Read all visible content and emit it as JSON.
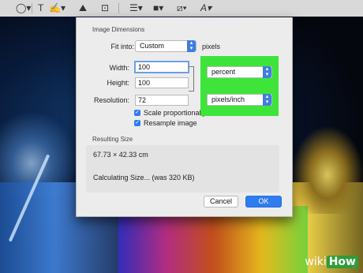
{
  "toolbar": {
    "items": [
      {
        "name": "shapes-icon",
        "glyph": "◯▾"
      },
      {
        "name": "text-icon",
        "glyph": "T"
      },
      {
        "name": "sign-icon",
        "glyph": "✍▾"
      },
      {
        "name": "adjust-color-icon",
        "glyph": "⛰"
      },
      {
        "name": "crop-icon",
        "glyph": "⊡"
      },
      {
        "name": "line-style-icon",
        "glyph": "☰▾"
      },
      {
        "name": "border-color-icon",
        "glyph": "■▾"
      },
      {
        "name": "fill-color-icon",
        "glyph": "⧄▾"
      },
      {
        "name": "text-style-icon",
        "glyph": "A▾"
      }
    ]
  },
  "dialog": {
    "title": "Image Dimensions",
    "fit_into_label": "Fit into:",
    "fit_into_value": "Custom",
    "fit_into_unit": "pixels",
    "width_label": "Width:",
    "width_value": "100",
    "height_label": "Height:",
    "height_value": "100",
    "resolution_label": "Resolution:",
    "resolution_value": "72",
    "size_unit": "percent",
    "resolution_unit": "pixels/inch",
    "scale_label": "Scale proportionally",
    "resample_label": "Resample image",
    "resulting_title": "Resulting Size",
    "resulting_dims": "67.73 × 42.33 cm",
    "resulting_calc": "Calculating Size... (was 320 KB)",
    "cancel_label": "Cancel",
    "ok_label": "OK"
  },
  "watermark": {
    "wiki": "wiki",
    "how": "How"
  },
  "colors": {
    "accent": "#2f7cf0",
    "highlight": "#3ee43a"
  }
}
